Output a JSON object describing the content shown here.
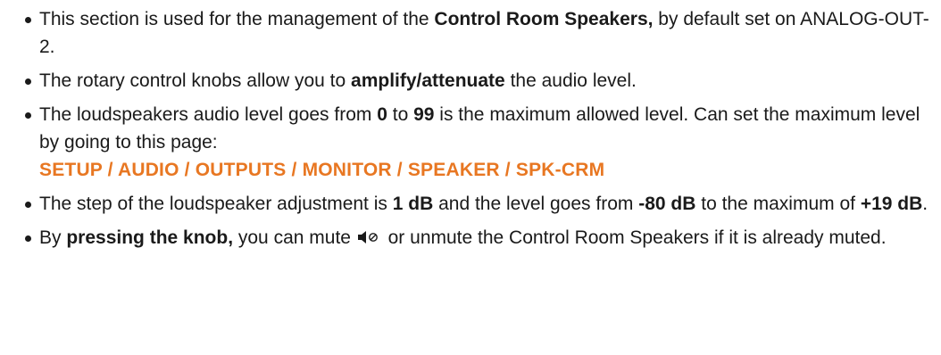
{
  "colors": {
    "text": "#1a1a1a",
    "highlight": "#e87722"
  },
  "bullets": [
    {
      "a": "This section is used for the management of the ",
      "b": "Control Room Speakers,",
      "c": " by default set on ANALOG-OUT-2."
    },
    {
      "a": "The rotary control knobs allow you to ",
      "b": "amplify/attenuate",
      "c": " the audio level."
    },
    {
      "a": "The loudspeakers audio level goes from ",
      "b1": "0",
      "mid": " to ",
      "b2": "99",
      "c": " is the maximum allowed level. Can set the maximum level by going to this page:",
      "path": "SETUP / AUDIO / OUTPUTS / MONITOR / SPEAKER / SPK-CRM"
    },
    {
      "a": "The step of the loudspeaker adjustment is ",
      "b1": "1 dB",
      "mid": " and the level goes from ",
      "b2": "-80 dB",
      "c": " to the maximum of ",
      "b3": "+19 dB",
      "d": "."
    },
    {
      "a": "By ",
      "b": "pressing the knob,",
      "c": " you can mute ",
      "icon": "speaker-mute-icon",
      "d": " or unmute the Control Room Speakers if it is already muted."
    }
  ]
}
